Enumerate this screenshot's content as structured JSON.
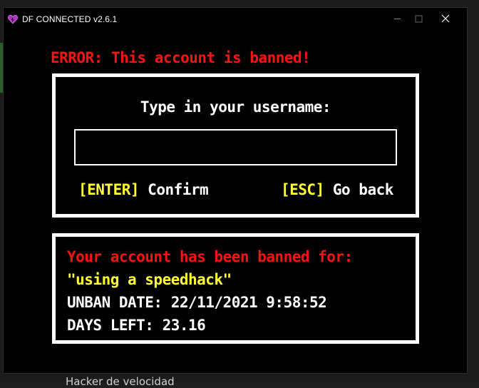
{
  "backdrop": {
    "bottom_text": "Hacker de velocidad"
  },
  "window": {
    "title": "DF CONNECTED v2.6.1",
    "icon": "heart-icon",
    "controls": {
      "minimize": "minimize-icon",
      "maximize": "maximize-icon",
      "close": "close-icon"
    }
  },
  "error": {
    "message": "ERROR: This account is banned!"
  },
  "login": {
    "prompt": "Type in your username:",
    "username_value": "",
    "confirm_key": "[ENTER]",
    "confirm_label": "Confirm",
    "back_key": "[ESC]",
    "back_label": "Go back"
  },
  "ban": {
    "heading": "Your account has been banned for:",
    "reason": "\"using a speedhack\"",
    "unban_date": "UNBAN DATE: 22/11/2021 9:58:52",
    "days_left": "DAYS LEFT: 23.16"
  },
  "colors": {
    "error_red": "#ff1111",
    "key_yellow": "#ffff33",
    "text_white": "#ffffff",
    "background": "#000000",
    "icon_purple": "#b030c8"
  }
}
